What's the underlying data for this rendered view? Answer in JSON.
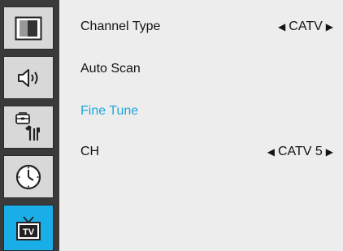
{
  "sidebar": {
    "tabs": [
      {
        "icon": "picture-icon",
        "active": false
      },
      {
        "icon": "sound-icon",
        "active": false
      },
      {
        "icon": "setup-tools-icon",
        "active": false
      },
      {
        "icon": "clock-icon",
        "active": false
      },
      {
        "icon": "tv-icon",
        "active": true,
        "label": "TV"
      }
    ]
  },
  "menu": {
    "items": [
      {
        "label": "Channel Type",
        "value": "CATV",
        "arrow_left": "◀",
        "arrow_right": "▶"
      },
      {
        "label": "Auto Scan"
      },
      {
        "label": "Fine Tune",
        "highlighted": true
      },
      {
        "label": "CH",
        "value": "CATV 5",
        "arrow_left": "◀",
        "arrow_right": "▶"
      }
    ]
  },
  "colors": {
    "highlight": "#1fa6dc",
    "active_tab": "#19aee8",
    "sidebar": "#3a3a3a",
    "panel": "#ededed"
  }
}
